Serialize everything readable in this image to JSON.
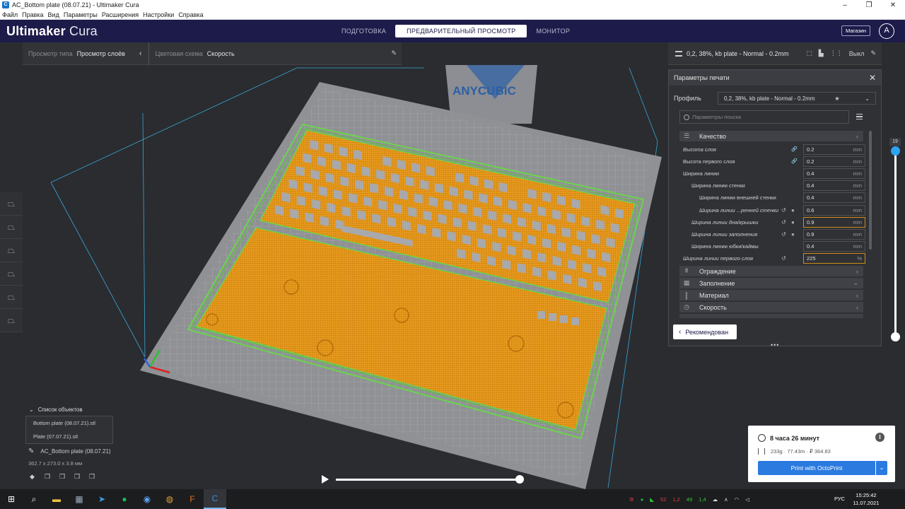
{
  "window": {
    "title": "AC_Bottom plate (08.07.21) - Ultimaker Cura",
    "menu": [
      "Файл",
      "Правка",
      "Вид",
      "Параметры",
      "Расширения",
      "Настройки",
      "Справка"
    ]
  },
  "header": {
    "brand_bold": "Ultimaker",
    "brand_rest": " Cura",
    "stages": [
      "ПОДГОТОВКА",
      "ПРЕДВАРИТЕЛЬНЫЙ ПРОСМОТР",
      "МОНИТОР"
    ],
    "active_stage": 1,
    "shop_label": "Магазин",
    "account_initial": "A"
  },
  "viewbar": {
    "view_type_label": "Просмотр типа",
    "view_type_value": "Просмотр слоёв",
    "color_scheme_label": "Цветовая схема",
    "color_scheme_value": "Скорость"
  },
  "printsetup": {
    "summary": "0,2, 38%, kb plate - Normal - 0.2mm",
    "off_label": "Выкл"
  },
  "panel": {
    "title": "Параметры печати",
    "profile_label": "Профиль",
    "profile_value": "0,2, 38%, kb plate - Normal - 0.2mm",
    "search_placeholder": "Параметры поиска",
    "quality_category": "Качество",
    "settings": [
      {
        "name": "Высота слоя",
        "value": "0.2",
        "unit": "mm",
        "indent": 0,
        "italic": true,
        "link": true
      },
      {
        "name": "Высота первого слоя",
        "value": "0.2",
        "unit": "mm",
        "indent": 0,
        "italic": false,
        "link": true
      },
      {
        "name": "Ширина линии",
        "value": "0.4",
        "unit": "mm",
        "indent": 0,
        "italic": false
      },
      {
        "name": "Ширина линии стенки",
        "value": "0.4",
        "unit": "mm",
        "indent": 1,
        "italic": false
      },
      {
        "name": "Ширина линии внешней стенки",
        "value": "0.4",
        "unit": "mm",
        "indent": 2,
        "italic": false
      },
      {
        "name": "Ширина линии ...ренней стенки",
        "value": "0.6",
        "unit": "mm",
        "indent": 2,
        "italic": true,
        "reset": true,
        "info": true
      },
      {
        "name": "Ширина линии дна/крышки",
        "value": "0.9",
        "unit": "mm",
        "indent": 1,
        "italic": true,
        "reset": true,
        "info": true,
        "warn": true
      },
      {
        "name": "Ширина линии заполнения",
        "value": "0.9",
        "unit": "mm",
        "indent": 1,
        "italic": true,
        "reset": true,
        "info": true
      },
      {
        "name": "Ширина линии юбки/каймы",
        "value": "0.4",
        "unit": "mm",
        "indent": 1,
        "italic": false
      },
      {
        "name": "Ширина линии первого слоя",
        "value": "225",
        "unit": "%",
        "indent": 0,
        "italic": true,
        "reset": true,
        "warn": true
      }
    ],
    "categories": [
      {
        "label": "Ограждение",
        "icon": "adhesion-icon"
      },
      {
        "label": "Заполнение",
        "icon": "infill-icon"
      },
      {
        "label": "Материал",
        "icon": "material-icon"
      },
      {
        "label": "Скорость",
        "icon": "speed-icon"
      }
    ],
    "recommended_label": "Рекомендован"
  },
  "layer_slider": {
    "current": "19",
    "position": 0.98
  },
  "objects": {
    "list_label": "Список объектов",
    "items": [
      "Bottom plate (08.07.21).stl",
      "Plate (07.07.21).stl"
    ],
    "active_name": "AC_Bottom plate (08.07.21)",
    "dimensions": "362.7 x 273.0 x 3.8 мм"
  },
  "print_info": {
    "time": "8 часа 26 минут",
    "material": "233g · 77.43m · ₽ 364.83",
    "button": "Print with OctoPrint"
  },
  "viewport_logo": "ANYCUBIC",
  "taskbar": {
    "tray_numbers": [
      "52",
      "1,2",
      "49",
      "1,4"
    ],
    "lang": "РУС",
    "time": "15:25:42",
    "date": "11.07.2021"
  },
  "colors": {
    "header": "#1d1b4a",
    "accent": "#2a7ae0",
    "infill": "#e69a1e",
    "skirt": "#6bd44a"
  }
}
